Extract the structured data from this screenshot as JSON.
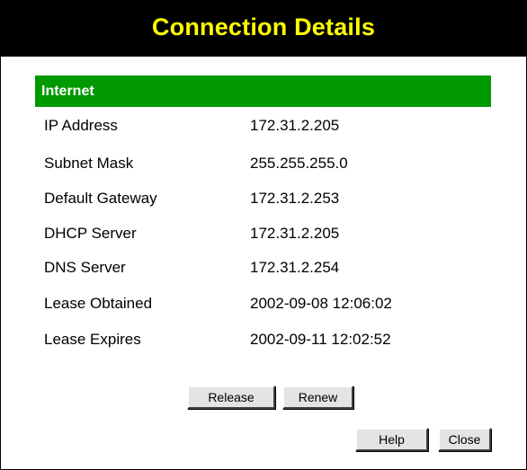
{
  "dialog": {
    "title": "Connection Details"
  },
  "section": {
    "title": "Internet"
  },
  "details": [
    {
      "label": "IP Address",
      "value": "172.31.2.205"
    },
    {
      "label": "Subnet Mask",
      "value": "255.255.255.0"
    },
    {
      "label": "Default Gateway",
      "value": "172.31.2.253"
    },
    {
      "label": "DHCP Server",
      "value": "172.31.2.205"
    },
    {
      "label": "DNS Server",
      "value": "172.31.2.254"
    },
    {
      "label": "Lease Obtained",
      "value": "2002-09-08 12:06:02"
    },
    {
      "label": "Lease Expires",
      "value": "2002-09-11 12:02:52"
    }
  ],
  "buttons": {
    "release": "Release",
    "renew": "Renew",
    "help": "Help",
    "close": "Close"
  },
  "colors": {
    "title_bar_background": "#000000",
    "title_text": "#ffff00",
    "section_header_background": "#009900",
    "section_header_text": "#ffffff"
  }
}
